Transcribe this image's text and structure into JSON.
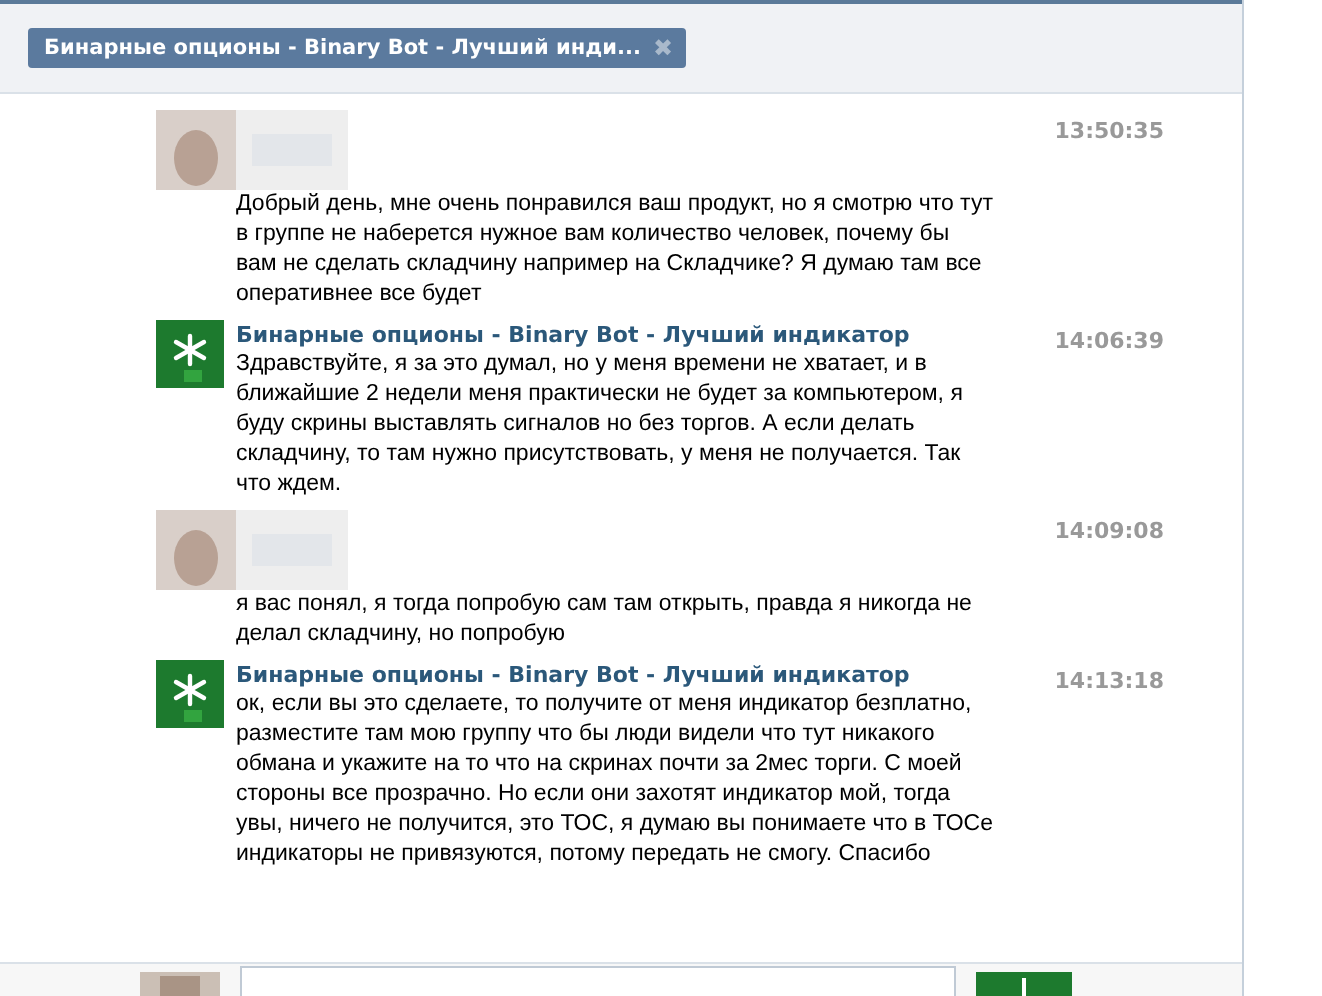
{
  "tab": {
    "title": "Бинарные опционы - Binary Bot - Лучший инди...",
    "close": "✖"
  },
  "messages": [
    {
      "kind": "user",
      "time": "13:50:35",
      "text": "Добрый день, мне очень понравился ваш продукт, но я смотрю что тут в группе не наберется нужное вам количество человек, почему бы вам не сделать складчину например на Складчике? Я думаю там все оперативнее все будет"
    },
    {
      "kind": "group",
      "author": "Бинарные опционы - Binary Bot - Лучший индикатор",
      "time": "14:06:39",
      "text": "Здравствуйте, я за это думал, но у меня времени не хватает, и в ближайшие 2 недели меня практически не будет за компьютером, я буду скрины выставлять сигналов но без торгов. А если делать складчину, то там нужно присутствовать, у меня не получается. Так что ждем."
    },
    {
      "kind": "user",
      "time": "14:09:08",
      "text": "я вас понял, я тогда попробую сам там открыть, правда я никогда не делал складчину, но попробую"
    },
    {
      "kind": "group",
      "author": "Бинарные опционы - Binary Bot - Лучший индикатор",
      "time": "14:13:18",
      "text": "ок, если вы это сделаете, то получите от меня индикатор безплатно, разместите там мою группу что бы люди видели что тут никакого обмана и укажите на то что на скринах почти за 2мес торги. С моей стороны все прозрачно. Но если они захотят индикатор мой, тогда увы, ничего не получится, это ТОС, я думаю вы понимаете что в ТОСе индикаторы не привязуются, потому передать не смогу. Спасибо"
    }
  ]
}
